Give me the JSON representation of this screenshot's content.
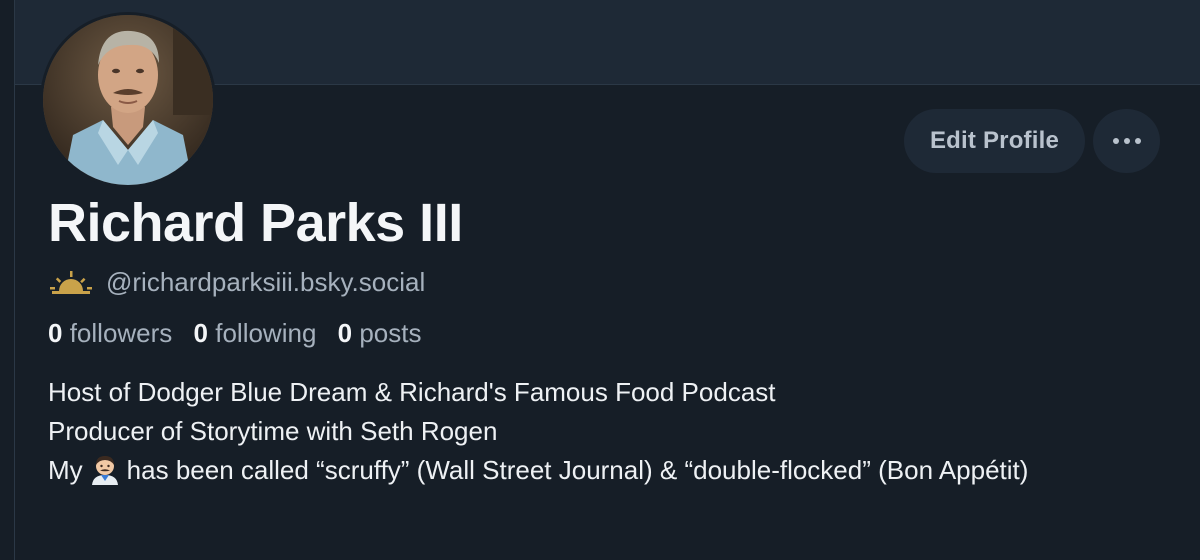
{
  "profile": {
    "display_name": "Richard Parks III",
    "handle": "@richardparksiii.bsky.social",
    "handle_icon": "sunrise-icon",
    "edit_profile_label": "Edit Profile",
    "more_icon": "ellipsis-icon",
    "stats": {
      "followers_count": "0",
      "followers_label": "followers",
      "following_count": "0",
      "following_label": "following",
      "posts_count": "0",
      "posts_label": "posts"
    },
    "bio": {
      "line1": "Host of Dodger Blue Dream & Richard's Famous Food Podcast",
      "line2": "Producer of Storytime with Seth Rogen",
      "line3_before_emoji": "My",
      "emoji": "man-with-mustache-emoji",
      "line3_after_emoji": "has been called “scruffy” (Wall Street Journal) & “double-flocked” (Bon Appétit)"
    }
  },
  "colors": {
    "background": "#161e27",
    "banner": "#1e2936",
    "button_bg": "#1e2936",
    "primary_text": "#f4f6f8",
    "secondary_text": "#a6b1bd",
    "handle_icon": "#c9a24a"
  }
}
